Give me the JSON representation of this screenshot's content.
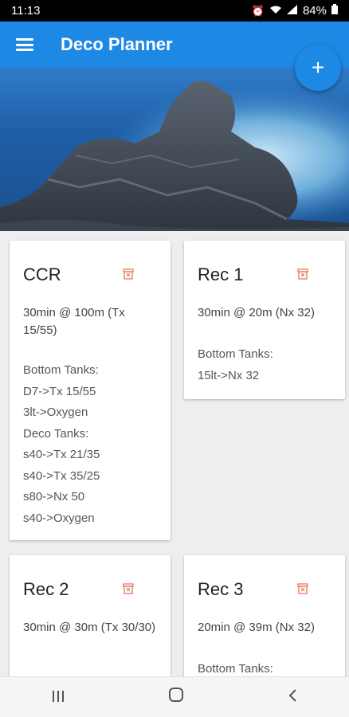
{
  "status": {
    "time": "11:13",
    "battery": "84%"
  },
  "appbar": {
    "title": "Deco Planner"
  },
  "fab": {
    "label": "+"
  },
  "cards": [
    {
      "title": "CCR",
      "summary": "30min @ 100m (Tx 15/55)",
      "bottom_label": "Bottom Tanks:",
      "bottom_tanks": [
        "D7->Tx 15/55",
        "3lt->Oxygen"
      ],
      "deco_label": "Deco Tanks:",
      "deco_tanks": [
        "s40->Tx 21/35",
        "s40->Tx 35/25",
        "s80->Nx 50",
        "s40->Oxygen"
      ]
    },
    {
      "title": "Rec 1",
      "summary": "30min @ 20m (Nx 32)",
      "bottom_label": "Bottom Tanks:",
      "bottom_tanks": [
        "15lt->Nx 32"
      ]
    },
    {
      "title": "Rec 2",
      "summary": "30min @ 30m (Tx 30/30)"
    },
    {
      "title": "Rec 3",
      "summary": "20min @ 39m (Nx 32)",
      "bottom_label": "Bottom Tanks:"
    }
  ],
  "colors": {
    "primary": "#1e88e5",
    "delete": "#e57a5a"
  },
  "icons": {
    "menu": "menu-icon",
    "add": "plus-icon",
    "delete": "trash-icon",
    "recent": "recents-icon",
    "home": "home-icon",
    "back": "back-icon"
  }
}
